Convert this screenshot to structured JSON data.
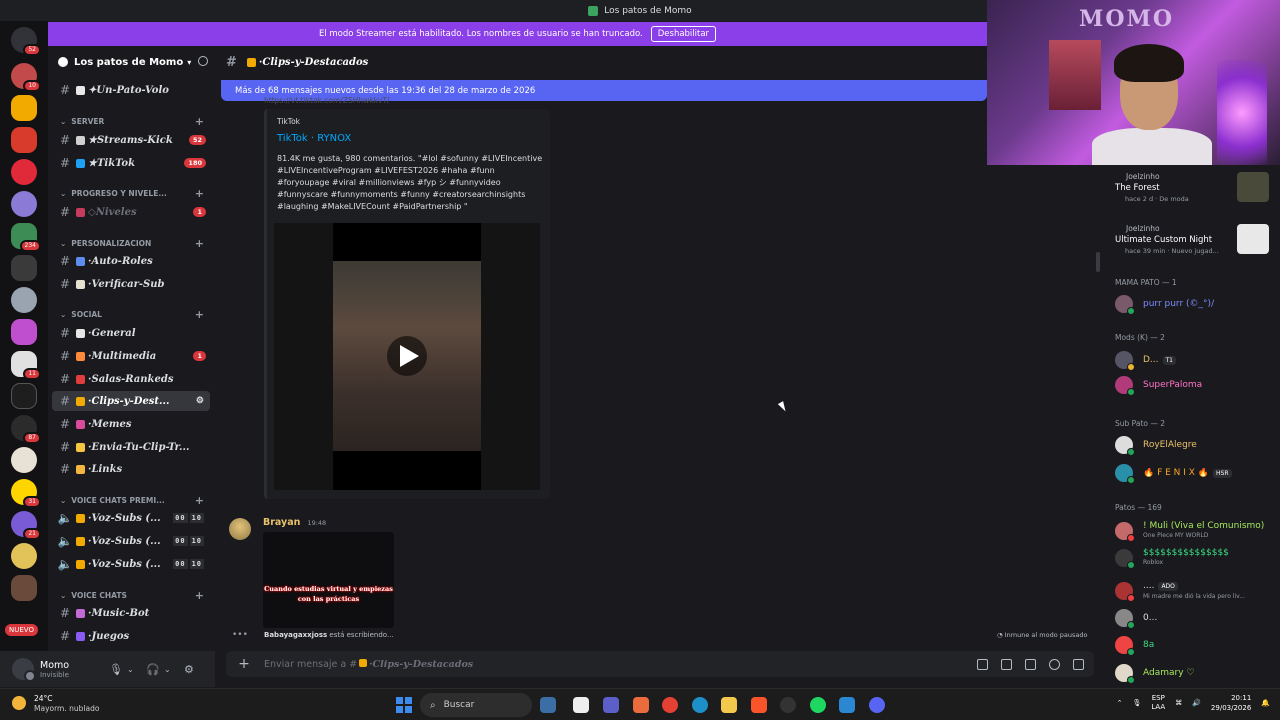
{
  "window": {
    "title": "Los patos de Momo"
  },
  "banner": {
    "text": "El modo Streamer está habilitado. Los nombres de usuario se han truncado.",
    "button": "Deshabilitar"
  },
  "guilds": {
    "badges": [
      "52",
      "10",
      "234",
      "11",
      "31",
      "21",
      "87"
    ],
    "new_label": "NUEVO"
  },
  "server": {
    "name": "Los patos de Momo"
  },
  "channels": [
    {
      "name": "✦Un-Pato-Volo"
    },
    {
      "category": "SERVER"
    },
    {
      "name": "★Streams-Kick",
      "count": "52"
    },
    {
      "name": "★TikTok",
      "count": "180"
    },
    {
      "category": "PROGRESO Y NIVELE..."
    },
    {
      "name": "◇Niveles",
      "count": "1"
    },
    {
      "category": "PERSONALIZACION"
    },
    {
      "name": "·Auto-Roles"
    },
    {
      "name": "·Verificar-Sub"
    },
    {
      "category": "SOCIAL"
    },
    {
      "name": "·General"
    },
    {
      "name": "·Multimedia",
      "count": "1"
    },
    {
      "name": "·Salas-Rankeds"
    },
    {
      "name": "·Clips-y-Dest..."
    },
    {
      "name": "·Memes"
    },
    {
      "name": "·Envia-Tu-Clip-Tr..."
    },
    {
      "name": "·Links"
    },
    {
      "category": "VOICE CHATS PREMI..."
    },
    {
      "name": "·Voz-Subs (...",
      "voice": [
        "00",
        "10"
      ]
    },
    {
      "name": "·Voz-Subs (...",
      "voice": [
        "00",
        "10"
      ]
    },
    {
      "name": "·Voz-Subs (...",
      "voice": [
        "00",
        "10"
      ]
    },
    {
      "category": "VOICE CHATS"
    },
    {
      "name": "·Music-Bot"
    },
    {
      "name": "·Juegos"
    }
  ],
  "user": {
    "name": "Momo",
    "status": "Invisible"
  },
  "header": {
    "channel": "·Clips-y-Destacados"
  },
  "new_messages": "Más de 68 mensajes nuevos desde las 19:36 del 28 de marzo de 2026",
  "embed": {
    "url": "https://vt.tiktok.com/ZSHhwkkvT/",
    "provider": "TikTok",
    "title": "TikTok · RYNOX",
    "description": "81.4K me gusta, 980 comentarios. \"#lol #sofunny #LIVEIncentive #LIVEIncentiveProgram #LIVEFEST2026 #haha #funn #foryoupage #viral #millionviews #fyp シ #funnyvideo #funnyscare #funnymoments #funny #creatorsearchinsights #laughing #MakeLIVECount #PaidPartnership \""
  },
  "message2": {
    "author": "Brayan",
    "time": "19:48",
    "caption": "Cuando estudias virtual y empiezas con las prácticas"
  },
  "typing": {
    "user": "Babayagaxxjoss",
    "text": " está escribiendo..."
  },
  "pause_note": "Inmune al modo pausado",
  "composer": {
    "placeholder_prefix": "Enviar mensaje a #",
    "placeholder_channel": "·Clips-y-Destacados"
  },
  "webcam": {
    "logo": "MOMO"
  },
  "activities": [
    {
      "user": "Joelzinho",
      "game": "The Forest",
      "meta": "hace 2 d  ·  De moda"
    },
    {
      "user": "Joelzinho",
      "game": "Ultimate Custom Night",
      "meta": "hace 39 min  ·  Nuevo jugad..."
    }
  ],
  "member_groups": [
    {
      "label": "MAMA PATO — 1"
    },
    {
      "label": "Mods (K) — 2"
    },
    {
      "label": "Sub Pato — 2"
    },
    {
      "label": "Patos — 169"
    }
  ],
  "members": [
    {
      "name": "purr purr (©_°)/",
      "color": "#7b8cff"
    },
    {
      "name": "D...",
      "tag": "T1",
      "color": "#e8c26a"
    },
    {
      "name": "SuperPaloma",
      "color": "#ff73c7"
    },
    {
      "name": "RoyElAlegre",
      "color": "#e8c26a"
    },
    {
      "name": "🔥 F E N I X 🔥",
      "tag": "HSR",
      "color": "#f5a623"
    },
    {
      "name": "! Muli (Viva el Comunismo)",
      "sub": "One Piece MY WORLD",
      "color": "#a4e65c"
    },
    {
      "name": "$$$$$$$$$$$$$$$",
      "sub": "Roblox",
      "color": "#3ddc84"
    },
    {
      "name": "....",
      "tag": "ADO",
      "sub": "Mi madre me dió la vida pero liv...",
      "color": "#dbdee1"
    },
    {
      "name": "0...",
      "color": "#dbdee1"
    },
    {
      "name": "8a",
      "color": "#3ddc84"
    },
    {
      "name": "Adamary ♡",
      "color": "#a4e65c"
    }
  ],
  "taskbar": {
    "temp": "24°C",
    "weather": "Mayorm. nublado",
    "search": "Buscar",
    "lang1": "ESP",
    "lang2": "LAA",
    "time": "20:11",
    "date": "29/03/2026"
  },
  "colors": {
    "accent": "#5865f2",
    "banner": "#8a3fe8",
    "link": "#00a8fc",
    "badge": "#da373c"
  }
}
